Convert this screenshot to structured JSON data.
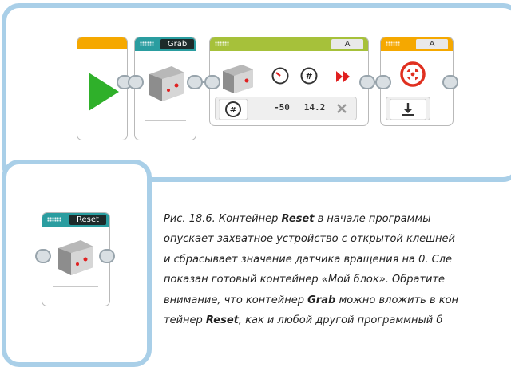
{
  "program": {
    "grab_block": {
      "label": "Grab"
    },
    "motor_block": {
      "port": "A",
      "power": "-50",
      "rotations": "14.2",
      "mode_icon": "counter-icon",
      "brake_icon": "close-icon"
    },
    "sensor_block": {
      "port": "A",
      "mode_icon": "download-icon"
    }
  },
  "reset_block": {
    "label": "Reset"
  },
  "caption": {
    "l1a": "Рис. 18.6. Контейнер ",
    "l1b": "Reset",
    "l1c": " в начале программы",
    "l2": "опускает захватное устройство с открытой клешней",
    "l3": "и сбрасывает значение датчика вращения на 0. Сле",
    "l4": "показан готовый контейнер «Мой блок». Обратите",
    "l5a": "внимание, что контейнер ",
    "l5b": "Grab",
    "l5c": " можно вложить в кон",
    "l6a": "тейнер ",
    "l6b": "Reset",
    "l6c": ", как и любой другой программный б"
  },
  "colors": {
    "start": "#f5a800",
    "myblock": "#2a9da0",
    "motor": "#a6c13a",
    "sensor": "#f5a800",
    "frame": "#a9cfe8"
  }
}
